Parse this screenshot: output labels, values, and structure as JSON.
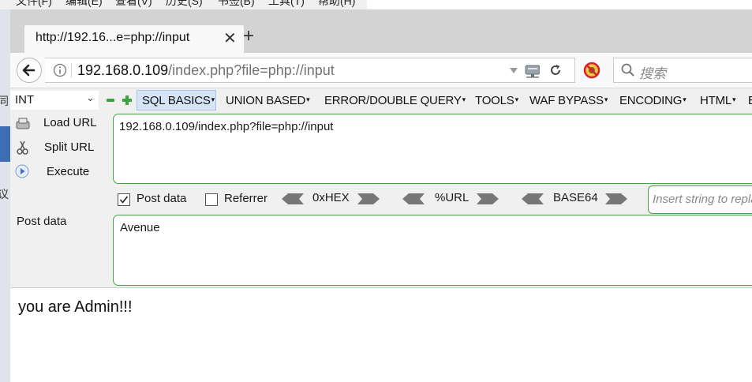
{
  "menubar": [
    "文件(F)",
    "编辑(E)",
    "查看(V)",
    "历史(S)",
    "书签(B)",
    "工具(T)",
    "帮助(H)"
  ],
  "left_strip": [
    "同",
    "议"
  ],
  "tab": {
    "title": "http://192.16...e=php://input",
    "close_icon": "close-icon",
    "new_tab_icon": "plus-icon"
  },
  "navbar": {
    "url_host": "192.168.0.109",
    "url_path": "/index.php?file=php://input",
    "search_placeholder": "搜索"
  },
  "hackbar": {
    "type_select": "INT",
    "menus": [
      "SQL BASICS",
      "UNION BASED",
      "ERROR/DOUBLE QUERY",
      "TOOLS",
      "WAF BYPASS",
      "ENCODING",
      "HTML",
      "E"
    ],
    "actions": {
      "load_url": "Load URL",
      "split_url": "Split URL",
      "execute": "Execute"
    },
    "url_value": "192.168.0.109/index.php?file=php://input",
    "post_data_checkbox": {
      "label": "Post data",
      "checked": true
    },
    "referrer_checkbox": {
      "label": "Referrer",
      "checked": false
    },
    "encoders": [
      "0xHEX",
      "%URL",
      "BASE64"
    ],
    "insert_placeholder": "Insert string to replace",
    "post_label": "Post data",
    "post_value": "Avenue"
  },
  "page": {
    "message": "you are Admin!!!"
  }
}
